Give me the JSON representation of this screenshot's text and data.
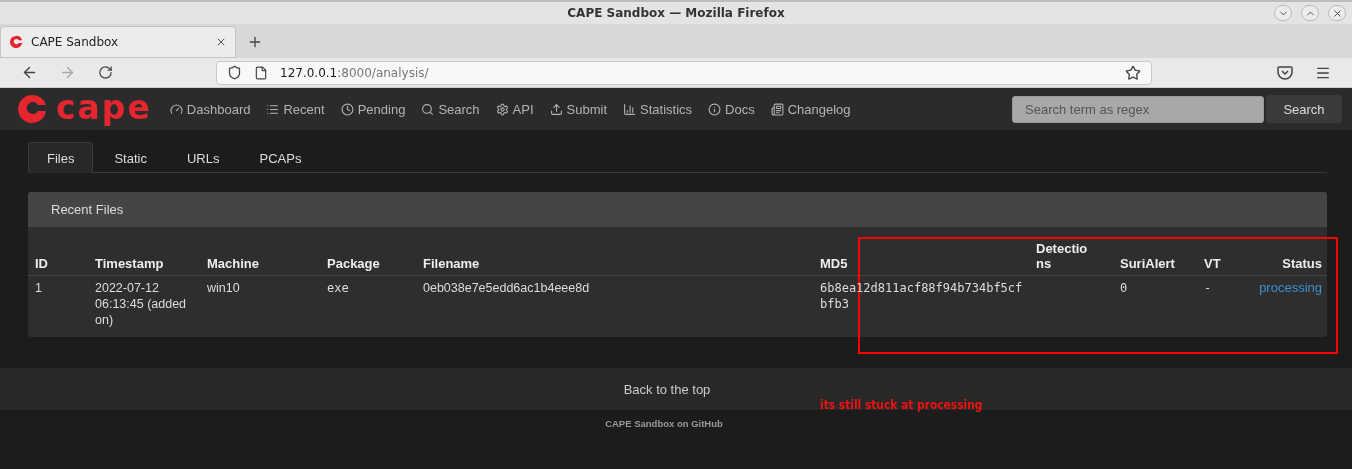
{
  "window": {
    "title": "CAPE Sandbox — Mozilla Firefox"
  },
  "browser_tab": {
    "title": "CAPE Sandbox",
    "selected": true
  },
  "address": {
    "host": "127.0.0.1",
    "path": ":8000/analysis/"
  },
  "site": {
    "logo": "cape",
    "nav": [
      {
        "label": "Dashboard"
      },
      {
        "label": "Recent"
      },
      {
        "label": "Pending"
      },
      {
        "label": "Search"
      },
      {
        "label": "API"
      },
      {
        "label": "Submit"
      },
      {
        "label": "Statistics"
      },
      {
        "label": "Docs"
      },
      {
        "label": "Changelog"
      }
    ],
    "search": {
      "placeholder": "Search term as regex",
      "button": "Search"
    }
  },
  "tabs": [
    {
      "label": "Files",
      "selected": true
    },
    {
      "label": "Static",
      "selected": false
    },
    {
      "label": "URLs",
      "selected": false
    },
    {
      "label": "PCAPs",
      "selected": false
    }
  ],
  "panel": {
    "title": "Recent Files",
    "columns": [
      "ID",
      "Timestamp",
      "Machine",
      "Package",
      "Filename",
      "MD5",
      "Detections",
      "SuriAlert",
      "VT",
      "Status"
    ],
    "rows": [
      {
        "id": "1",
        "timestamp": "2022-07-12 06:13:45 (added on)",
        "machine": "win10",
        "package": "exe",
        "filename": "0eb038e7e5edd6ac1b4eee8d",
        "md5": "6b8ea12d811acf88f94b734bf5cfbfb3",
        "suri_alert": "0",
        "vt": "-",
        "status": "processing"
      }
    ]
  },
  "footer": {
    "back_to_top": "Back to the top",
    "github": "CAPE Sandbox on GitHub"
  },
  "annotation": {
    "text": "its still stuck at processing"
  }
}
